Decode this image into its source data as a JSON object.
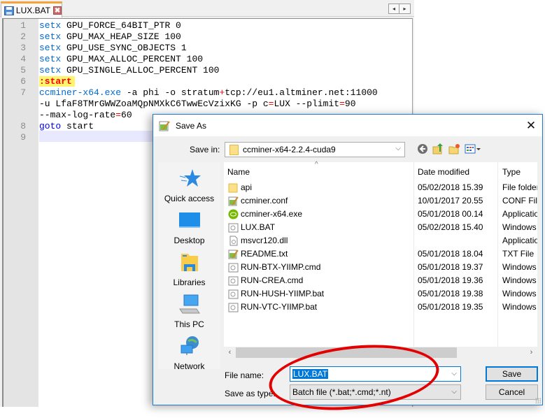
{
  "editor": {
    "tab": {
      "label": "LUX.BAT",
      "close": "✖"
    },
    "tab_scroll": {
      "left": "◂",
      "right": "▸"
    },
    "lines": [
      {
        "n": "1",
        "parts": [
          [
            "kw",
            "setx"
          ],
          [
            "",
            " GPU_FORCE_64BIT_PTR 0"
          ]
        ]
      },
      {
        "n": "2",
        "parts": [
          [
            "kw",
            "setx"
          ],
          [
            "",
            " GPU_MAX_HEAP_SIZE 100"
          ]
        ]
      },
      {
        "n": "3",
        "parts": [
          [
            "kw",
            "setx"
          ],
          [
            "",
            " GPU_USE_SYNC_OBJECTS 1"
          ]
        ]
      },
      {
        "n": "4",
        "parts": [
          [
            "kw",
            "setx"
          ],
          [
            "",
            " GPU_MAX_ALLOC_PERCENT 100"
          ]
        ]
      },
      {
        "n": "5",
        "parts": [
          [
            "kw",
            "setx"
          ],
          [
            "",
            " GPU_SINGLE_ALLOC_PERCENT 100"
          ]
        ]
      },
      {
        "n": "6",
        "parts": [
          [
            "lbl",
            ":start"
          ]
        ]
      },
      {
        "n": "7",
        "parts": [
          [
            "kw",
            "ccminer-x64.exe"
          ],
          [
            "",
            " -a phi -o stratum"
          ],
          [
            "red",
            "+"
          ],
          [
            "",
            "tcp://eu1.altminer.net:11000"
          ]
        ]
      },
      {
        "n": "",
        "parts": [
          [
            "",
            "-u LfaF8TMrGWWZoaMQpNMXkC6TwwEcVzixKG -p c"
          ],
          [
            "red",
            "="
          ],
          [
            "",
            "LUX --plimit"
          ],
          [
            "red",
            "="
          ],
          [
            "",
            "90"
          ]
        ]
      },
      {
        "n": "",
        "parts": [
          [
            "",
            "--max-log-rate"
          ],
          [
            "red",
            "="
          ],
          [
            "",
            "60"
          ]
        ]
      },
      {
        "n": "8",
        "parts": [
          [
            "kw2",
            "goto"
          ],
          [
            "",
            " start"
          ]
        ]
      },
      {
        "n": "9",
        "parts": []
      }
    ]
  },
  "dialog": {
    "title": "Save As",
    "close": "✕",
    "save_in_label": "Save in:",
    "save_in_value": "ccminer-x64-2.2.4-cuda9",
    "nav_icons": [
      "back-icon",
      "up-folder-icon",
      "new-folder-icon",
      "view-menu-icon"
    ],
    "places": [
      {
        "label": "Quick access",
        "icon": "quick-access-icon"
      },
      {
        "label": "Desktop",
        "icon": "desktop-icon"
      },
      {
        "label": "Libraries",
        "icon": "libraries-icon"
      },
      {
        "label": "This PC",
        "icon": "this-pc-icon"
      },
      {
        "label": "Network",
        "icon": "network-icon"
      }
    ],
    "columns": {
      "name": "Name",
      "date": "Date modified",
      "type": "Type"
    },
    "files": [
      {
        "name": "api",
        "date": "05/02/2018 15.39",
        "type": "File folder",
        "icon": "folder"
      },
      {
        "name": "ccminer.conf",
        "date": "10/01/2017 20.55",
        "type": "CONF File",
        "icon": "notepad"
      },
      {
        "name": "ccminer-x64.exe",
        "date": "05/01/2018 00.14",
        "type": "Application",
        "icon": "nvidia"
      },
      {
        "name": "LUX.BAT",
        "date": "05/02/2018 15.40",
        "type": "Windows Batch File",
        "icon": "batch"
      },
      {
        "name": "msvcr120.dll",
        "date": "",
        "type": "Application extension",
        "icon": "dll"
      },
      {
        "name": "README.txt",
        "date": "05/01/2018 18.04",
        "type": "TXT File",
        "icon": "notepad"
      },
      {
        "name": "RUN-BTX-YIIMP.cmd",
        "date": "05/01/2018 19.37",
        "type": "Windows Command Script",
        "icon": "batch"
      },
      {
        "name": "RUN-CREA.cmd",
        "date": "05/01/2018 19.36",
        "type": "Windows Command Script",
        "icon": "batch"
      },
      {
        "name": "RUN-HUSH-YIIMP.bat",
        "date": "05/01/2018 19.38",
        "type": "Windows Batch File",
        "icon": "batch"
      },
      {
        "name": "RUN-VTC-YIIMP.bat",
        "date": "05/01/2018 19.35",
        "type": "Windows Batch File",
        "icon": "batch"
      }
    ],
    "scroll_left": "‹",
    "scroll_right": "›",
    "file_name_label": "File name:",
    "file_name_value": "LUX.BAT",
    "save_type_label": "Save as type:",
    "save_type_value": "Batch file (*.bat;*.cmd;*.nt)",
    "save_button": "Save",
    "cancel_button": "Cancel",
    "dropdown_arrow": "⌵"
  },
  "colors": {
    "tab_accent": "#f8a23a",
    "keyword": "#0069d0",
    "operator": "#ff0000",
    "label_bg": "#fdf56e",
    "dialog_border": "#1a7ad4",
    "annotation": "#e30000"
  }
}
